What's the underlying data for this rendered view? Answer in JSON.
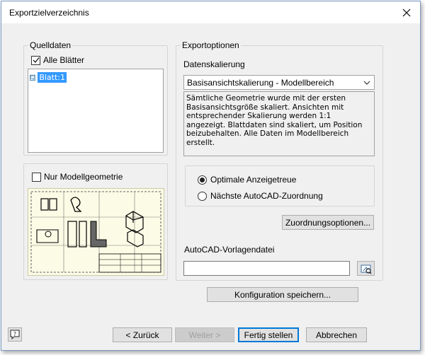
{
  "window": {
    "title": "Exportzielverzeichnis"
  },
  "source": {
    "group_label": "Quelldaten",
    "all_sheets_label": "Alle Blätter",
    "all_sheets_checked": true,
    "sheets": [
      {
        "label": "Blatt:1"
      }
    ],
    "model_geometry_label": "Nur Modellgeometrie",
    "model_geometry_checked": false
  },
  "export": {
    "group_label": "Exportoptionen",
    "scaling_label": "Datenskalierung",
    "scaling_value": "Basisansichtskalierung - Modellbereich",
    "scaling_description": "Sämtliche Geometrie wurde mit der ersten Basisansichtsgröße skaliert. Ansichten mit entsprechender Skalierung werden 1:1 angezeigt. Blattdaten sind skaliert, um Position beizubehalten. Alle Daten im Modellbereich erstellt.",
    "radio_optimal": "Optimale Anzeigetreue",
    "radio_nearest": "Nächste AutoCAD-Zuordnung",
    "selected_radio": "optimal",
    "mapping_button": "Zuordnungsoptionen...",
    "template_label": "AutoCAD-Vorlagendatei",
    "template_value": ""
  },
  "buttons": {
    "save_config": "Konfiguration speichern...",
    "back": "< Zurück",
    "next": "Weiter >",
    "finish": "Fertig stellen",
    "cancel": "Abbrechen"
  },
  "icons": {
    "close": "close-icon",
    "help": "help-icon",
    "browse": "folder-browse-icon",
    "sheet": "sheet-icon",
    "dropdown": "chevron-down-icon"
  }
}
